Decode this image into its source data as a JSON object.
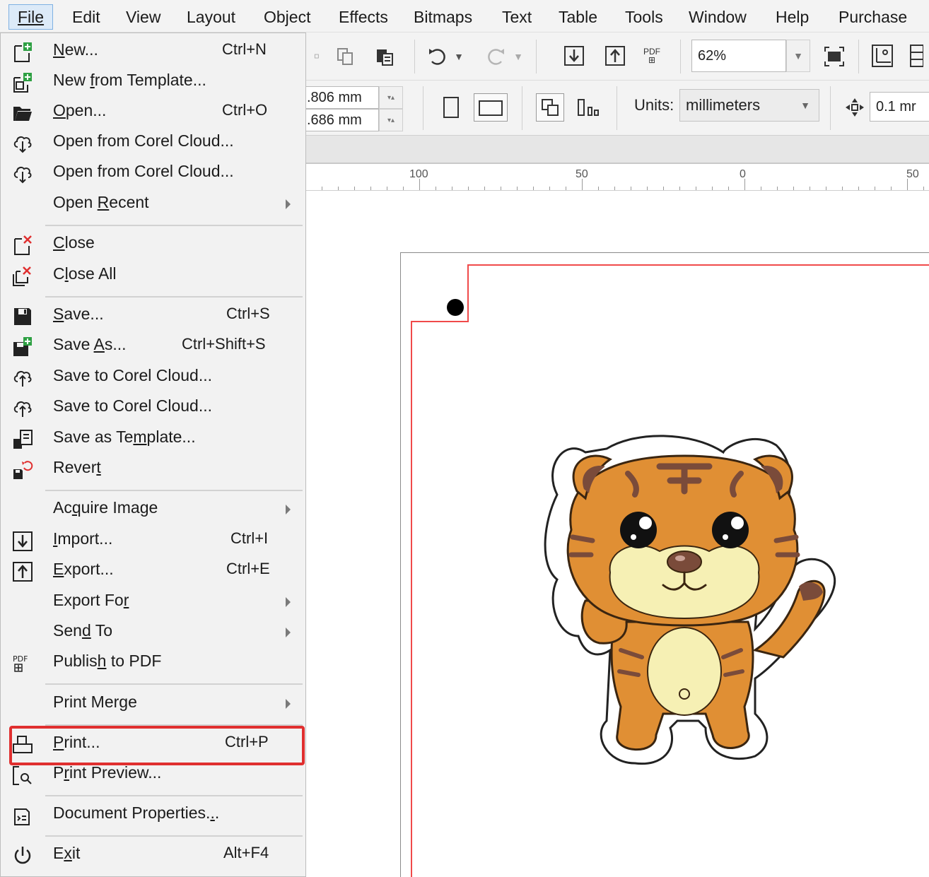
{
  "menubar": {
    "items": [
      "File",
      "Edit",
      "View",
      "Layout",
      "Object",
      "Effects",
      "Bitmaps",
      "Text",
      "Table",
      "Tools",
      "Window",
      "Help",
      "Purchase"
    ],
    "active": "File"
  },
  "toolbar": {
    "zoom_value": "62%",
    "pos_x": ".806 mm",
    "pos_y": ".686 mm",
    "units_label": "Units:",
    "units_value": "millimeters",
    "nudge_value": "0.1 mr",
    "pdf_label": "PDF"
  },
  "ruler": {
    "labels": [
      "100",
      "50",
      "0",
      "50"
    ]
  },
  "file_menu": {
    "items": [
      {
        "label": "New...",
        "shortcut": "Ctrl+N",
        "icon": "new-document-icon"
      },
      {
        "label": "New from Template...",
        "shortcut": "",
        "icon": "new-from-template-icon"
      },
      {
        "label": "Open...",
        "shortcut": "Ctrl+O",
        "icon": "folder-open-icon"
      },
      {
        "label": "Open from Corel Cloud...",
        "shortcut": "",
        "icon": "cloud-download-icon"
      },
      {
        "label": "Open from Corel Cloud...",
        "shortcut": "",
        "icon": "cloud-download-icon"
      },
      {
        "label": "Open Recent",
        "shortcut": "",
        "icon": ""
      },
      {
        "label": "Close",
        "shortcut": "",
        "icon": "close-document-icon"
      },
      {
        "label": "Close All",
        "shortcut": "",
        "icon": "close-all-icon"
      },
      {
        "label": "Save...",
        "shortcut": "Ctrl+S",
        "icon": "save-icon"
      },
      {
        "label": "Save As...",
        "shortcut": "Ctrl+Shift+S",
        "icon": "save-as-icon"
      },
      {
        "label": "Save to Corel Cloud...",
        "shortcut": "",
        "icon": "cloud-upload-icon"
      },
      {
        "label": "Save to Corel Cloud...",
        "shortcut": "",
        "icon": "cloud-upload-icon"
      },
      {
        "label": "Save as Template...",
        "shortcut": "",
        "icon": "save-template-icon"
      },
      {
        "label": "Revert",
        "shortcut": "",
        "icon": "revert-icon"
      },
      {
        "label": "Acquire Image",
        "shortcut": "",
        "icon": ""
      },
      {
        "label": "Import...",
        "shortcut": "Ctrl+I",
        "icon": "import-icon"
      },
      {
        "label": "Export...",
        "shortcut": "Ctrl+E",
        "icon": "export-icon"
      },
      {
        "label": "Export For",
        "shortcut": "",
        "icon": ""
      },
      {
        "label": "Send To",
        "shortcut": "",
        "icon": ""
      },
      {
        "label": "Publish to PDF",
        "shortcut": "",
        "icon": "pdf-icon"
      },
      {
        "label": "Print Merge",
        "shortcut": "",
        "icon": ""
      },
      {
        "label": "Print...",
        "shortcut": "Ctrl+P",
        "icon": "print-icon"
      },
      {
        "label": "Print Preview...",
        "shortcut": "",
        "icon": "print-preview-icon"
      },
      {
        "label": "Document Properties...",
        "shortcut": "",
        "icon": "document-properties-icon"
      },
      {
        "label": "Exit",
        "shortcut": "Alt+F4",
        "icon": "power-icon"
      }
    ],
    "highlighted": "Print..."
  },
  "colors": {
    "highlight_border": "#e02f2f",
    "page_bleed_line": "#f04a4a",
    "active_menu_bg": "#dceaf8"
  }
}
